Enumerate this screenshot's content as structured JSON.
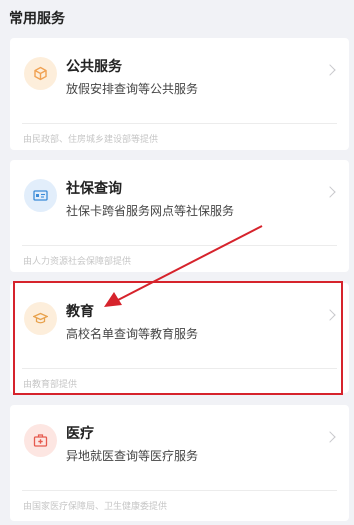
{
  "section_title": "常用服务",
  "cards": [
    {
      "title": "公共服务",
      "desc": "放假安排查询等公共服务",
      "source": "由民政部、住房城乡建设部等提供",
      "icon": "cube-icon",
      "icon_color": "#f0a152",
      "icon_bg": "#fdeedb"
    },
    {
      "title": "社保查询",
      "desc": "社保卡跨省服务网点等社保服务",
      "source": "由人力资源社会保障部提供",
      "icon": "id-card-icon",
      "icon_color": "#3b8bd8",
      "icon_bg": "#e2eefb"
    },
    {
      "title": "教育",
      "desc": "高校名单查询等教育服务",
      "source": "由教育部提供",
      "icon": "graduation-cap-icon",
      "icon_color": "#e8a24d",
      "icon_bg": "#fdeedb"
    },
    {
      "title": "医疗",
      "desc": "异地就医查询等医疗服务",
      "source": "由国家医疗保障局、卫生健康委提供",
      "icon": "medical-kit-icon",
      "icon_color": "#e65a4e",
      "icon_bg": "#fde6e2"
    }
  ],
  "annotation": {
    "highlight_color": "#d6232c"
  }
}
